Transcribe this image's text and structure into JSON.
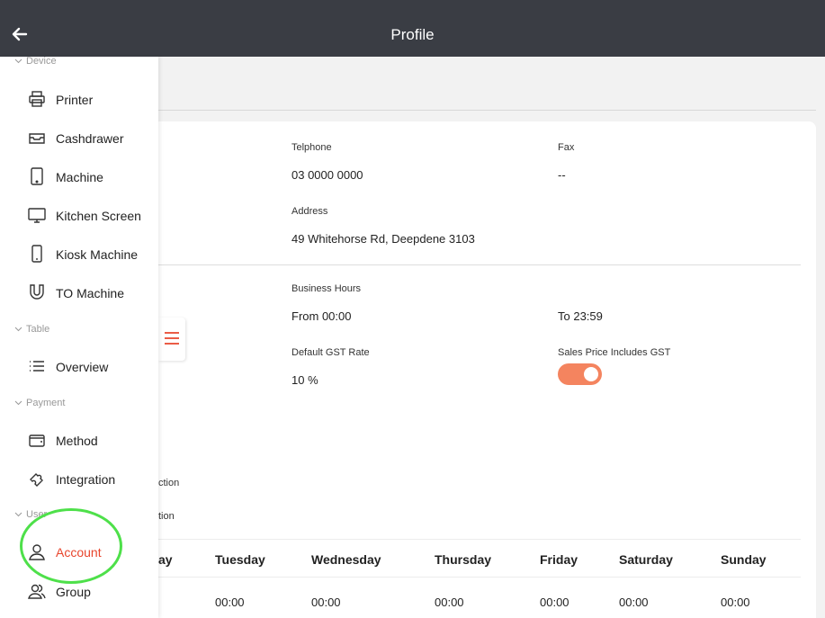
{
  "header": {
    "title": "Profile"
  },
  "profile": {
    "telephone_label": "Telphone",
    "telephone_value": "03 0000 0000",
    "fax_label": "Fax",
    "fax_value": "--",
    "address_label": "Address",
    "address_value": "49 Whitehorse Rd, Deepdene 3103",
    "hours_label": "Business Hours",
    "hours_from": "From 00:00",
    "hours_to": "To 23:59",
    "gst_label": "Default GST Rate",
    "gst_value": "10 %",
    "sales_gst_label": "Sales Price Includes GST",
    "sales_gst_on": true,
    "partial_1": "ction",
    "partial_2": "tion"
  },
  "hours_table": {
    "headers": [
      "ay",
      "Tuesday",
      "Wednesday",
      "Thursday",
      "Friday",
      "Saturday",
      "Sunday"
    ],
    "values": [
      "00:00",
      "00:00",
      "00:00",
      "00:00",
      "00:00",
      "00:00"
    ]
  },
  "sidebar": {
    "top_section": "Device",
    "items_device": [
      "Printer",
      "Cashdrawer",
      "Machine",
      "Kitchen Screen",
      "Kiosk Machine",
      "TO Machine"
    ],
    "section_table": "Table",
    "item_overview": "Overview",
    "section_payment": "Payment",
    "item_method": "Method",
    "item_integration": "Integration",
    "section_user": "User",
    "item_account": "Account",
    "item_group": "Group"
  },
  "colors": {
    "accent": "#e8452c",
    "toggle": "#f4845f",
    "topbar": "#3a3d44",
    "highlight": "#4ee04a"
  }
}
